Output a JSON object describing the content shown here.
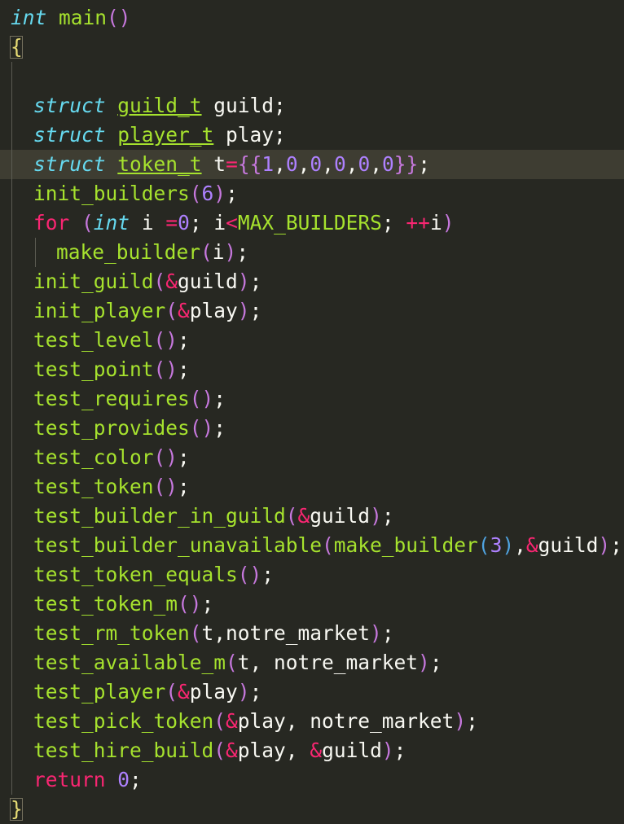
{
  "colors": {
    "background": "#272822",
    "current_line": "#3e3d32",
    "default": "#f8f8f2",
    "type": "#66d9ef",
    "function": "#a6e22e",
    "keyword": "#f92672",
    "number": "#ae81ff",
    "paren": "#c678dd",
    "brace": "#e6db74",
    "operator": "#f92672",
    "indent_guide": "#5b5b52"
  },
  "editor": {
    "highlighted_line": 4,
    "lines": [
      {
        "indent": 0,
        "tokens": [
          [
            "int",
            "type"
          ],
          [
            " ",
            "plain"
          ],
          [
            "main",
            "func"
          ],
          [
            "()",
            "paren"
          ]
        ]
      },
      {
        "indent": 0,
        "tokens": [
          [
            "{",
            "brace"
          ]
        ]
      },
      {
        "indent": 0,
        "tokens": []
      },
      {
        "indent": 1,
        "tokens": [
          [
            "struct",
            "type"
          ],
          [
            " ",
            "plain"
          ],
          [
            "guild_t",
            "typename"
          ],
          [
            " guild;",
            "plain"
          ]
        ]
      },
      {
        "indent": 1,
        "tokens": [
          [
            "struct",
            "type"
          ],
          [
            " ",
            "plain"
          ],
          [
            "player_t",
            "typename"
          ],
          [
            " play;",
            "plain"
          ]
        ]
      },
      {
        "indent": 1,
        "tokens": [
          [
            "struct",
            "type"
          ],
          [
            " ",
            "plain"
          ],
          [
            "token_t",
            "typename"
          ],
          [
            " t",
            "plain"
          ],
          [
            "=",
            "op"
          ],
          [
            "{{",
            "paren"
          ],
          [
            "1",
            "num"
          ],
          [
            ",",
            "plain"
          ],
          [
            "0",
            "num"
          ],
          [
            ",",
            "plain"
          ],
          [
            "0",
            "num"
          ],
          [
            ",",
            "plain"
          ],
          [
            "0",
            "num"
          ],
          [
            ",",
            "plain"
          ],
          [
            "0",
            "num"
          ],
          [
            ",",
            "plain"
          ],
          [
            "0",
            "num"
          ],
          [
            "}}",
            "paren"
          ],
          [
            ";",
            "plain"
          ]
        ]
      },
      {
        "indent": 1,
        "tokens": [
          [
            "init_builders",
            "func"
          ],
          [
            "(",
            "paren"
          ],
          [
            "6",
            "num"
          ],
          [
            ")",
            "paren"
          ],
          [
            ";",
            "plain"
          ]
        ]
      },
      {
        "indent": 1,
        "tokens": [
          [
            "for",
            "kw"
          ],
          [
            " ",
            "plain"
          ],
          [
            "(",
            "paren"
          ],
          [
            "int",
            "type"
          ],
          [
            " i ",
            "plain"
          ],
          [
            "=",
            "op"
          ],
          [
            "0",
            "num"
          ],
          [
            "; i",
            "plain"
          ],
          [
            "<",
            "op"
          ],
          [
            "MAX_BUILDERS",
            "func"
          ],
          [
            "; ",
            "plain"
          ],
          [
            "++",
            "op"
          ],
          [
            "i",
            "plain"
          ],
          [
            ")",
            "paren"
          ]
        ]
      },
      {
        "indent": 2,
        "tokens": [
          [
            "make_builder",
            "func"
          ],
          [
            "(",
            "paren"
          ],
          [
            "i",
            "plain"
          ],
          [
            ")",
            "paren"
          ],
          [
            ";",
            "plain"
          ]
        ]
      },
      {
        "indent": 1,
        "tokens": [
          [
            "init_guild",
            "func"
          ],
          [
            "(",
            "paren"
          ],
          [
            "&",
            "op"
          ],
          [
            "guild",
            "plain"
          ],
          [
            ")",
            "paren"
          ],
          [
            ";",
            "plain"
          ]
        ]
      },
      {
        "indent": 1,
        "tokens": [
          [
            "init_player",
            "func"
          ],
          [
            "(",
            "paren"
          ],
          [
            "&",
            "op"
          ],
          [
            "play",
            "plain"
          ],
          [
            ")",
            "paren"
          ],
          [
            ";",
            "plain"
          ]
        ]
      },
      {
        "indent": 1,
        "tokens": [
          [
            "test_level",
            "func"
          ],
          [
            "()",
            "paren"
          ],
          [
            ";",
            "plain"
          ]
        ]
      },
      {
        "indent": 1,
        "tokens": [
          [
            "test_point",
            "func"
          ],
          [
            "()",
            "paren"
          ],
          [
            ";",
            "plain"
          ]
        ]
      },
      {
        "indent": 1,
        "tokens": [
          [
            "test_requires",
            "func"
          ],
          [
            "()",
            "paren"
          ],
          [
            ";",
            "plain"
          ]
        ]
      },
      {
        "indent": 1,
        "tokens": [
          [
            "test_provides",
            "func"
          ],
          [
            "()",
            "paren"
          ],
          [
            ";",
            "plain"
          ]
        ]
      },
      {
        "indent": 1,
        "tokens": [
          [
            "test_color",
            "func"
          ],
          [
            "()",
            "paren"
          ],
          [
            ";",
            "plain"
          ]
        ]
      },
      {
        "indent": 1,
        "tokens": [
          [
            "test_token",
            "func"
          ],
          [
            "()",
            "paren"
          ],
          [
            ";",
            "plain"
          ]
        ]
      },
      {
        "indent": 1,
        "tokens": [
          [
            "test_builder_in_guild",
            "func"
          ],
          [
            "(",
            "paren"
          ],
          [
            "&",
            "op"
          ],
          [
            "guild",
            "plain"
          ],
          [
            ")",
            "paren"
          ],
          [
            ";",
            "plain"
          ]
        ]
      },
      {
        "indent": 1,
        "tokens": [
          [
            "test_builder_unavailable",
            "func"
          ],
          [
            "(",
            "paren"
          ],
          [
            "make_builder",
            "func"
          ],
          [
            "(",
            "paren2"
          ],
          [
            "3",
            "num"
          ],
          [
            ")",
            "paren2"
          ],
          [
            ",",
            "plain"
          ],
          [
            "&",
            "op"
          ],
          [
            "guild",
            "plain"
          ],
          [
            ")",
            "paren"
          ],
          [
            ";",
            "plain"
          ]
        ]
      },
      {
        "indent": 1,
        "tokens": [
          [
            "test_token_equals",
            "func"
          ],
          [
            "()",
            "paren"
          ],
          [
            ";",
            "plain"
          ]
        ]
      },
      {
        "indent": 1,
        "tokens": [
          [
            "test_token_m",
            "func"
          ],
          [
            "()",
            "paren"
          ],
          [
            ";",
            "plain"
          ]
        ]
      },
      {
        "indent": 1,
        "tokens": [
          [
            "test_rm_token",
            "func"
          ],
          [
            "(",
            "paren"
          ],
          [
            "t,notre_market",
            "plain"
          ],
          [
            ")",
            "paren"
          ],
          [
            ";",
            "plain"
          ]
        ]
      },
      {
        "indent": 1,
        "tokens": [
          [
            "test_available_m",
            "func"
          ],
          [
            "(",
            "paren"
          ],
          [
            "t, notre_market",
            "plain"
          ],
          [
            ")",
            "paren"
          ],
          [
            ";",
            "plain"
          ]
        ]
      },
      {
        "indent": 1,
        "tokens": [
          [
            "test_player",
            "func"
          ],
          [
            "(",
            "paren"
          ],
          [
            "&",
            "op"
          ],
          [
            "play",
            "plain"
          ],
          [
            ")",
            "paren"
          ],
          [
            ";",
            "plain"
          ]
        ]
      },
      {
        "indent": 1,
        "tokens": [
          [
            "test_pick_token",
            "func"
          ],
          [
            "(",
            "paren"
          ],
          [
            "&",
            "op"
          ],
          [
            "play, notre_market",
            "plain"
          ],
          [
            ")",
            "paren"
          ],
          [
            ";",
            "plain"
          ]
        ]
      },
      {
        "indent": 1,
        "tokens": [
          [
            "test_hire_build",
            "func"
          ],
          [
            "(",
            "paren"
          ],
          [
            "&",
            "op"
          ],
          [
            "play, ",
            "plain"
          ],
          [
            "&",
            "op"
          ],
          [
            "guild",
            "plain"
          ],
          [
            ")",
            "paren"
          ],
          [
            ";",
            "plain"
          ]
        ]
      },
      {
        "indent": 1,
        "tokens": [
          [
            "return",
            "kw"
          ],
          [
            " ",
            "plain"
          ],
          [
            "0",
            "num"
          ],
          [
            ";",
            "plain"
          ]
        ]
      },
      {
        "indent": 0,
        "tokens": [
          [
            "}",
            "brace"
          ]
        ]
      }
    ]
  }
}
